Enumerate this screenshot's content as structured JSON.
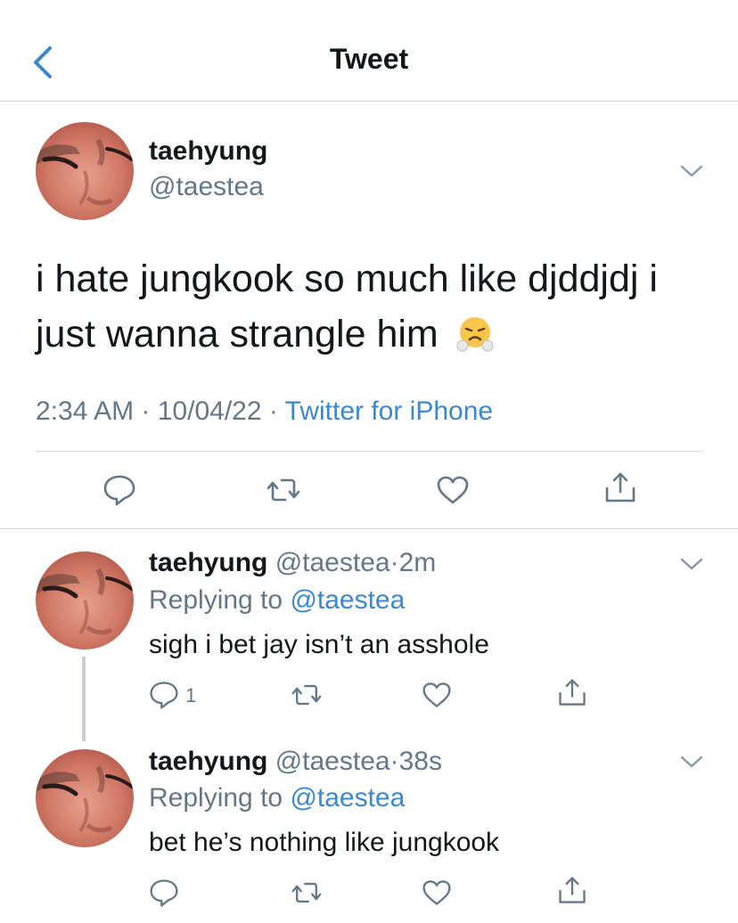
{
  "header": {
    "title": "Tweet",
    "back_icon": "chevron-left-icon"
  },
  "main_tweet": {
    "display_name": "taehyung",
    "handle": "@taestea",
    "text": "i hate jungkook so much like djddjdj i just wanna strangle him",
    "emoji": "😤",
    "time": "2:34 AM",
    "date": "10/04/22",
    "source": "Twitter for iPhone",
    "meta_sep": " · "
  },
  "replies": [
    {
      "display_name": "taehyung",
      "handle": "@taestea",
      "time": "2m",
      "replying_label": "Replying to",
      "replying_to": "@taestea",
      "text": "sigh i bet jay isn’t an asshole",
      "reply_count": "1"
    },
    {
      "display_name": "taehyung",
      "handle": "@taestea",
      "time": "38s",
      "replying_label": "Replying to",
      "replying_to": "@taestea",
      "text": "bet he’s nothing like jungkook",
      "reply_count": ""
    }
  ],
  "colors": {
    "link": "#3d87cc",
    "muted": "#657786",
    "text": "#14171a",
    "divider": "#d8dde1"
  }
}
